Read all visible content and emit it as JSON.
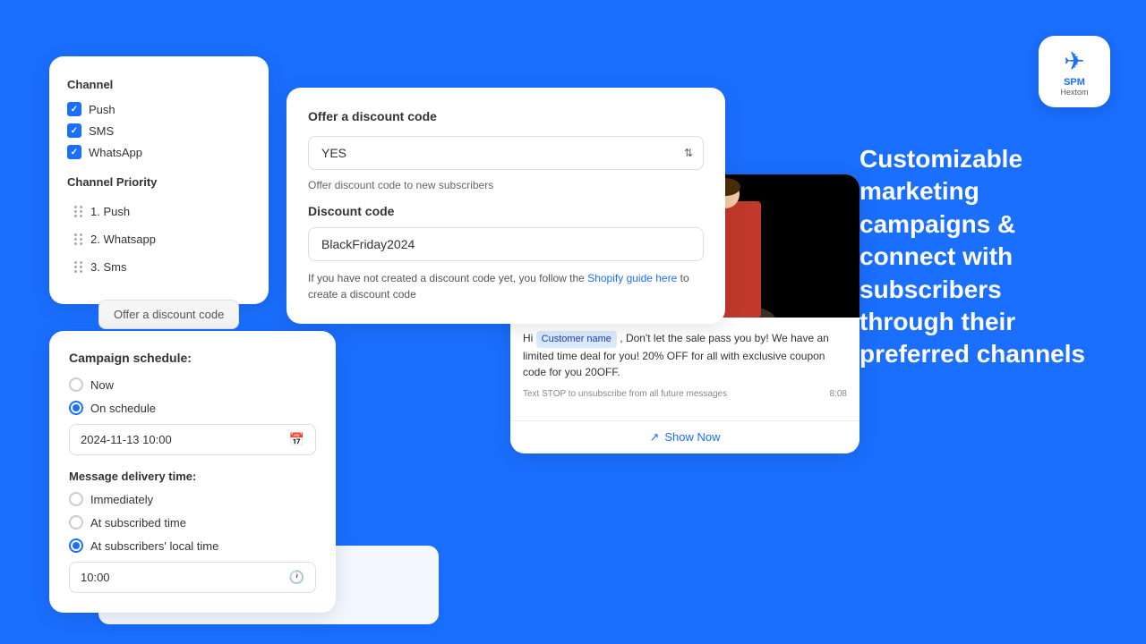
{
  "background_color": "#1a6fff",
  "logo": {
    "icon": "✈",
    "title": "SPM",
    "subtitle": "Hextom"
  },
  "hero_text": "Customizable marketing campaigns & connect with subscribers through their preferred channels",
  "channel_card": {
    "title": "Channel",
    "channels": [
      {
        "name": "Push",
        "checked": true
      },
      {
        "name": "SMS",
        "checked": true
      },
      {
        "name": "WhatsApp",
        "checked": true
      }
    ],
    "priority_title": "Channel Priority",
    "priorities": [
      {
        "order": "1.",
        "name": "Push"
      },
      {
        "order": "2.",
        "name": "Whatsapp"
      },
      {
        "order": "3.",
        "name": "Sms"
      }
    ]
  },
  "discount_card": {
    "title": "Offer a discount code",
    "select_value": "YES",
    "hint": "Offer discount code to new subscribers",
    "code_title": "Discount code",
    "code_value": "BlackFriday2024",
    "guide_prefix": "If you have not created a discount code yet, you follow the ",
    "guide_link": "Shopify guide here",
    "guide_suffix": " to create a discount code"
  },
  "campaign_card": {
    "title": "Campaign schedule:",
    "options": [
      {
        "label": "Now",
        "selected": false
      },
      {
        "label": "On schedule",
        "selected": true
      }
    ],
    "schedule_value": "2024-11-13 10:00",
    "delivery_title": "Message delivery time:",
    "delivery_options": [
      {
        "label": "Immediately",
        "selected": false
      },
      {
        "label": "At subscribed time",
        "selected": false
      },
      {
        "label": "At subscribers' local time",
        "selected": true
      }
    ],
    "time_value": "10:00"
  },
  "whatsapp_message": {
    "greeting": "Hi ",
    "customer_name": "Customer name",
    "message_body": " , Don't let the sale pass you by! We have an limited time deal for you! 20% OFF for all with exclusive coupon code for you 20OFF.",
    "unsubscribe_text": "Text STOP to unsubscribe from all future messages",
    "timestamp": "8:08",
    "show_now": "Show Now"
  },
  "behind_button": {
    "label": "Offer a discount code"
  },
  "behind_campaign": {
    "options": [
      {
        "label": "Immediately",
        "selected": false
      },
      {
        "label": "At subscribed time",
        "selected": false
      },
      {
        "label": "At subscribers' local time",
        "selected": true
      }
    ]
  }
}
